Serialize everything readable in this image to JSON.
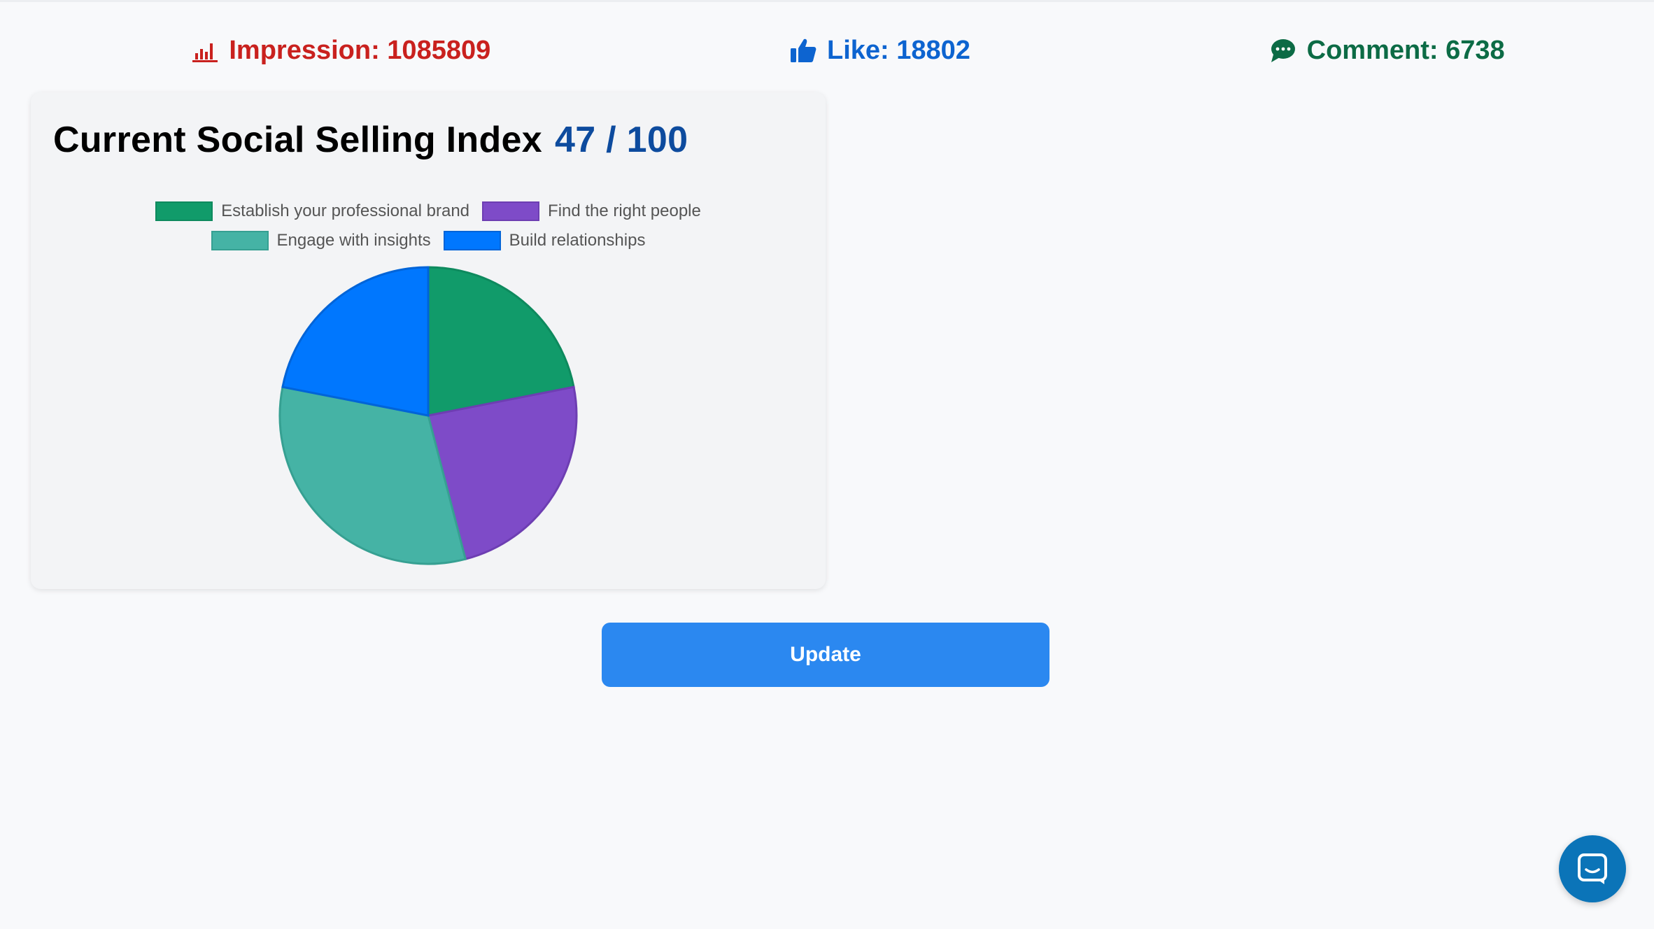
{
  "stats": {
    "impression": {
      "label": "Impression: 1085809",
      "icon": "bar-chart-icon",
      "color": "#c9211e"
    },
    "like": {
      "label": "Like: 18802",
      "icon": "thumbs-up-icon",
      "color": "#0d64d0"
    },
    "comment": {
      "label": "Comment: 6738",
      "icon": "chat-bubble-icon",
      "color": "#0c6b45"
    }
  },
  "card": {
    "title": "Current Social Selling Index",
    "score": "47 / 100"
  },
  "chart_data": {
    "type": "pie",
    "categories": [
      "Establish your professional brand",
      "Find the right people",
      "Engage with insights",
      "Build relationships"
    ],
    "values": [
      10.3,
      11.3,
      15.1,
      10.3
    ],
    "colors": [
      "#119b6a",
      "#7e4bc8",
      "#45b3a5",
      "#0077fe"
    ],
    "borders": [
      "#0e8a5e",
      "#6d3eb2",
      "#36a092",
      "#0064d8"
    ],
    "legend": "top"
  },
  "update_button": {
    "label": "Update"
  },
  "chat_launcher": {
    "icon": "chat-launcher-icon"
  }
}
